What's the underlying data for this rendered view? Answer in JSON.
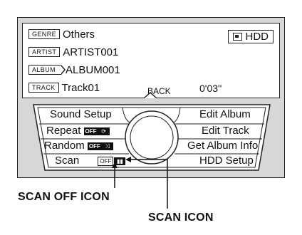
{
  "info_panel": {
    "genre": {
      "tag": "GENRE",
      "value": "Others"
    },
    "artist": {
      "tag": "ARTIST",
      "value": "ARTIST001"
    },
    "album": {
      "tag": "ALBUM",
      "value": "ALBUM001"
    },
    "track": {
      "tag": "TRACK",
      "value": "Track01"
    },
    "time": "0'03''",
    "source": "HDD"
  },
  "back_label": "BACK",
  "menu": {
    "left": [
      {
        "label": "Sound Setup"
      },
      {
        "label": "Repeat",
        "badge": "OFF"
      },
      {
        "label": "Random",
        "badge": "OFF"
      },
      {
        "label": "Scan",
        "badge": "OFF"
      }
    ],
    "right": [
      {
        "label": "Edit Album"
      },
      {
        "label": "Edit Track"
      },
      {
        "label": "Get Album Info"
      },
      {
        "label": "HDD Setup"
      }
    ]
  },
  "callouts": {
    "scan_off_icon": "SCAN OFF ICON",
    "scan_icon": "SCAN ICON"
  },
  "icons": [
    "hdd-icon",
    "back-arrow-icon",
    "repeat-icon",
    "random-icon",
    "scan-icon",
    "dial-knob-icon"
  ]
}
